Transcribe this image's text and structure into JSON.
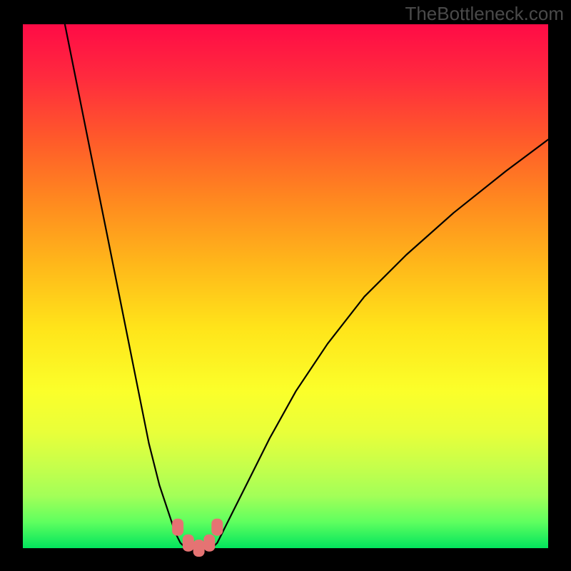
{
  "watermark": "TheBottleneck.com",
  "chart_data": {
    "type": "line",
    "title": "",
    "xlabel": "",
    "ylabel": "",
    "xlim": [
      0,
      100
    ],
    "ylim": [
      0,
      100
    ],
    "legend": false,
    "grid": false,
    "background": "rainbow-gradient (red→orange→yellow→green, top→bottom) representing bottleneck severity",
    "axes_visible": false,
    "series": [
      {
        "name": "curve-left",
        "description": "Left branch of bottleneck V-curve descending from top-left toward minimum",
        "x": [
          8,
          10,
          12,
          14,
          16,
          18,
          20,
          22,
          24,
          26,
          28,
          29,
          30,
          31
        ],
        "y": [
          100,
          90,
          80,
          70,
          60,
          50,
          40,
          30,
          20,
          12,
          6,
          3,
          1,
          0
        ]
      },
      {
        "name": "curve-right",
        "description": "Right branch of bottleneck V-curve ascending from minimum toward upper right",
        "x": [
          36,
          37,
          38,
          40,
          43,
          47,
          52,
          58,
          65,
          73,
          82,
          92,
          100
        ],
        "y": [
          0,
          1,
          3,
          7,
          13,
          21,
          30,
          39,
          48,
          56,
          64,
          72,
          78
        ]
      },
      {
        "name": "flat-minimum",
        "description": "Flat minimum segment at bottom of V",
        "x": [
          31,
          33,
          36
        ],
        "y": [
          0,
          0,
          0
        ]
      }
    ],
    "markers": [
      {
        "name": "marker-left-outer",
        "x": 29.5,
        "y": 4,
        "shape": "rounded-rect",
        "color": "#e57373"
      },
      {
        "name": "marker-left-inner",
        "x": 31.5,
        "y": 1,
        "shape": "rounded-rect",
        "color": "#e57373"
      },
      {
        "name": "marker-right-inner",
        "x": 35.5,
        "y": 1,
        "shape": "rounded-rect",
        "color": "#e57373"
      },
      {
        "name": "marker-right-outer",
        "x": 37.0,
        "y": 4,
        "shape": "rounded-rect",
        "color": "#e57373"
      },
      {
        "name": "marker-bottom-mid",
        "x": 33.5,
        "y": 0,
        "shape": "rounded-rect",
        "color": "#e57373"
      }
    ],
    "annotations": [],
    "notes": "No numeric axis tick labels are visible; x/y coordinates are estimated percentages of the plot area. Curve resembles an absolute-value-like bottleneck profile with minimum near x≈33%."
  },
  "colors": {
    "background_frame": "#000000",
    "gradient_top": "#ff0b46",
    "gradient_bottom": "#02e45d",
    "curve": "#000000",
    "marker": "#e57373",
    "watermark": "#4a4a4a"
  }
}
